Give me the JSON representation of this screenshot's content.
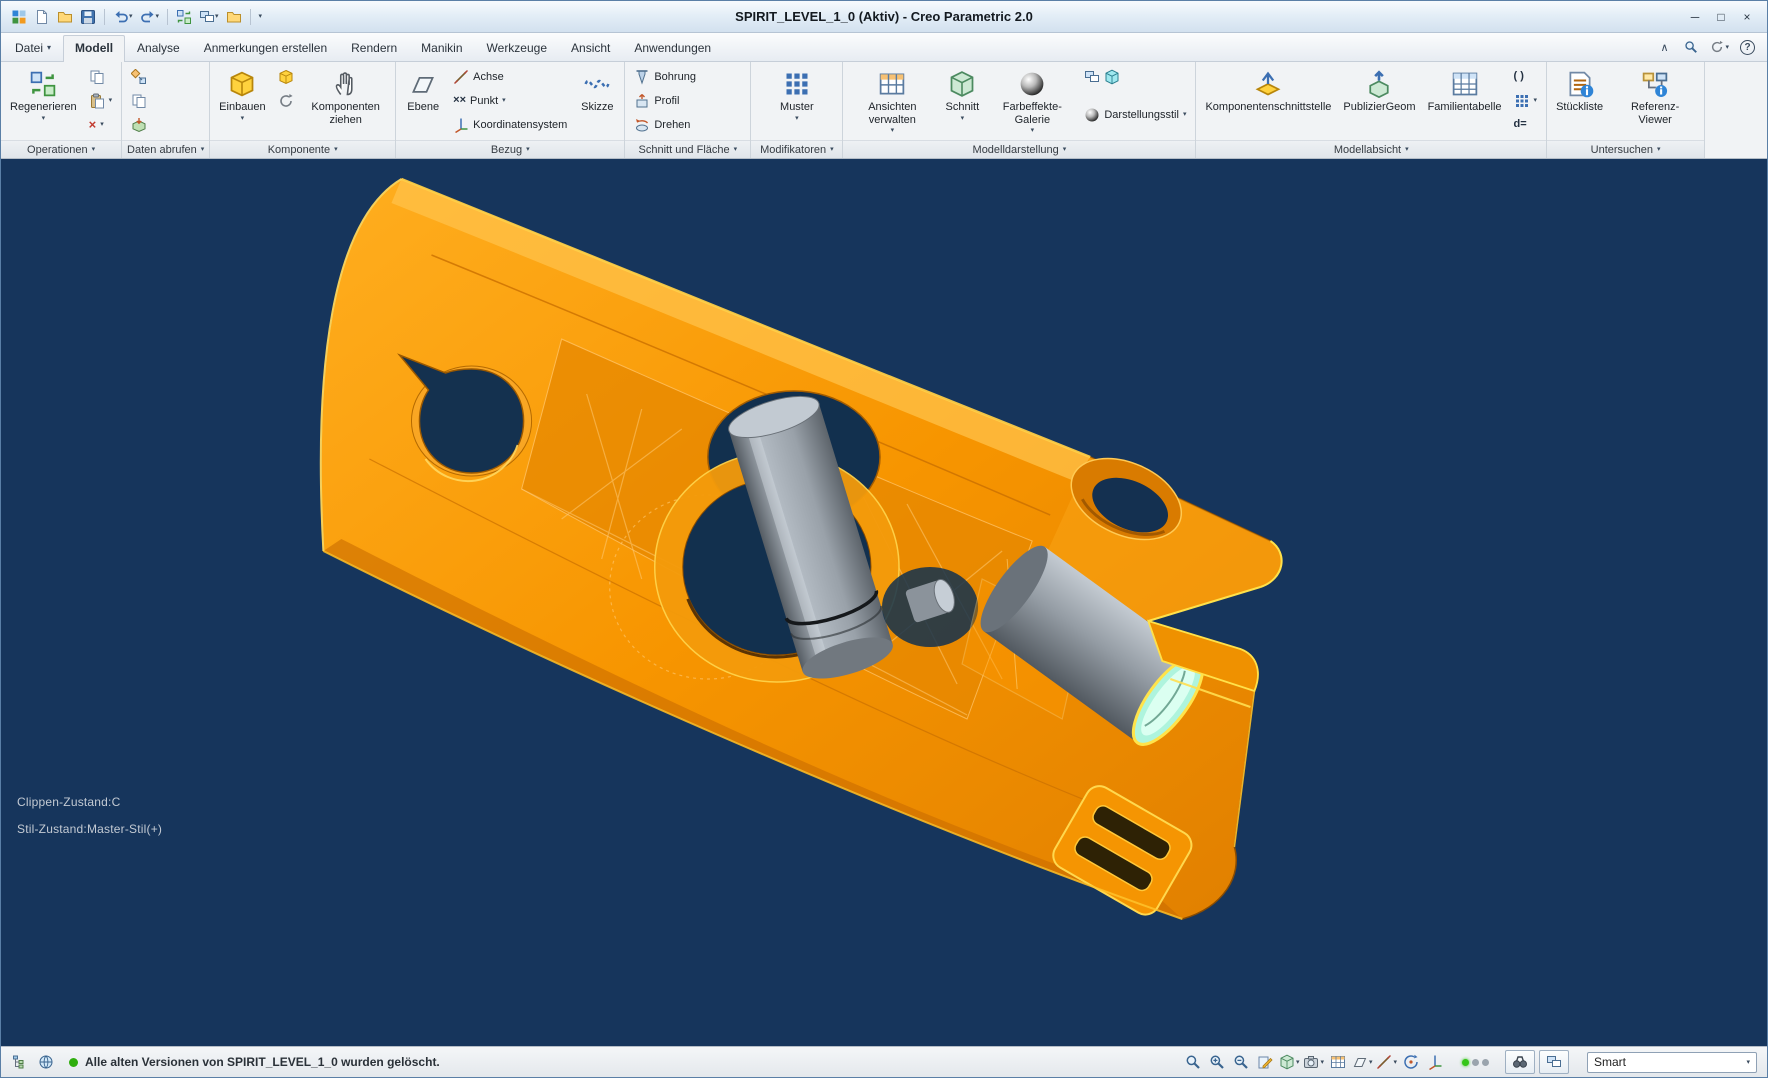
{
  "window": {
    "title": "SPIRIT_LEVEL_1_0 (Aktiv) - Creo Parametric 2.0"
  },
  "glyphs": {
    "dropdown": "▾",
    "minimize": "─",
    "restore": "□",
    "close": "×",
    "collapse_ribbon": "∧",
    "help": "?",
    "delete": "×",
    "points": "××"
  },
  "tabs": {
    "datei": "Datei",
    "modell": "Modell",
    "analyse": "Analyse",
    "anmerkungen": "Anmerkungen erstellen",
    "rendern": "Rendern",
    "manikin": "Manikin",
    "werkzeuge": "Werkzeuge",
    "ansicht": "Ansicht",
    "anwendungen": "Anwendungen"
  },
  "ribbon": {
    "operationen": {
      "footer": "Operationen",
      "regenerieren": "Regenerieren"
    },
    "daten_abrufen": {
      "footer": "Daten abrufen"
    },
    "komponente": {
      "footer": "Komponente",
      "einbauen": "Einbauen",
      "komponenten_ziehen": "Komponenten ziehen"
    },
    "bezug": {
      "footer": "Bezug",
      "ebene": "Ebene",
      "achse": "Achse",
      "punkt": "Punkt",
      "koordinatensystem": "Koordinatensystem",
      "skizze": "Skizze"
    },
    "schnitt_und_flaeche": {
      "footer": "Schnitt und Fläche",
      "bohrung": "Bohrung",
      "profil": "Profil",
      "drehen": "Drehen"
    },
    "modifikatoren": {
      "footer": "Modifikatoren",
      "muster": "Muster"
    },
    "modelldarstellung": {
      "footer": "Modelldarstellung",
      "ansichten_verwalten": "Ansichten verwalten",
      "schnitt": "Schnitt",
      "farbeffekte_galerie": "Farbeffekte-Galerie",
      "darstellungsstil": "Darstellungsstil"
    },
    "modellabsicht": {
      "footer": "Modellabsicht",
      "komponentenschnittstelle": "Komponentenschnittstelle",
      "publiziergeom": "PublizierGeom",
      "familientabelle": "Familientabelle",
      "parameter": "( )",
      "relationen": "d="
    },
    "untersuchen": {
      "footer": "Untersuchen",
      "stueckliste": "Stückliste",
      "referenz_viewer": "Referenz-Viewer"
    }
  },
  "viewport": {
    "clip_state_label": "Clippen-Zustand:C",
    "style_state_label": "Stil-Zustand:Master-Stil(+)"
  },
  "statusbar": {
    "message": "Alle alten Versionen von SPIRIT_LEVEL_1_0 wurden gelöscht.",
    "selection_filter": "Smart"
  },
  "colors": {
    "viewport_bg": "#16355c",
    "model_orange": "#f79500",
    "vial_gray": "#99a1a9",
    "vial_cap_cyan": "#aef4dd",
    "status_ok_green": "#35c618"
  }
}
